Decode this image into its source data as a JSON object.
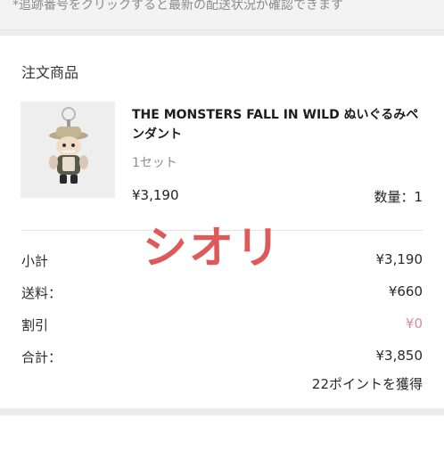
{
  "header": {
    "tracking_note": "*追跡番号をクリックすると最新の配送状況が確認できます"
  },
  "order": {
    "section_title": "注文商品",
    "product": {
      "name": "THE MONSTERS FALL IN WILD ぬいぐるみペンダント",
      "variant": "1セット",
      "price": "¥3,190",
      "quantity": "数量：1"
    },
    "watermark": "シオリ",
    "summary": [
      {
        "label": "小計",
        "value": "¥3,190"
      },
      {
        "label": "送料：",
        "value": "¥660"
      },
      {
        "label": "割引",
        "value": "¥0"
      },
      {
        "label": "合計：",
        "value": "¥3,850"
      }
    ],
    "points": "22ポイントを獲得"
  },
  "colors": {
    "watermark": "#dc4c4c",
    "discount": "#d98aa0",
    "page_bg": "#ececec",
    "card_bg": "#ffffff"
  }
}
